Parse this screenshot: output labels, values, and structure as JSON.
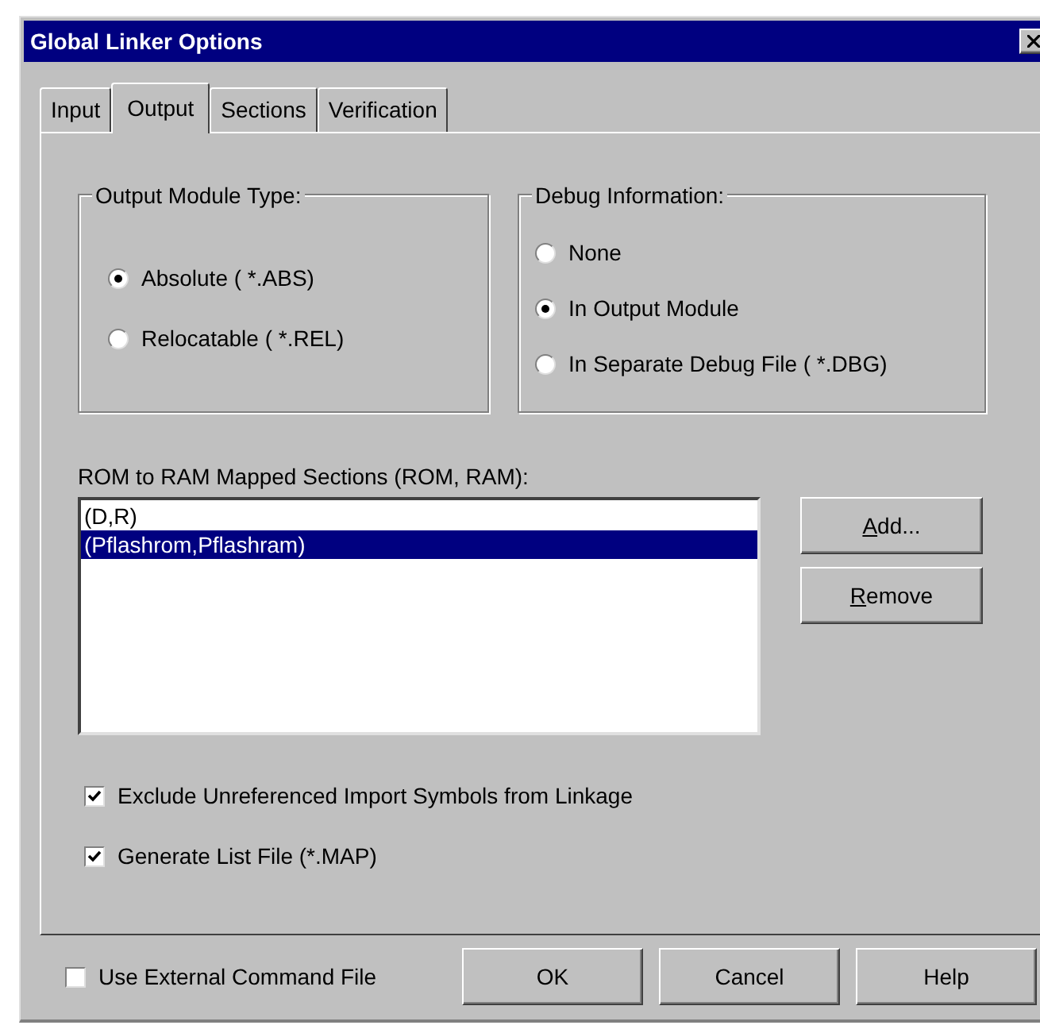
{
  "window": {
    "title": "Global Linker Options"
  },
  "tabs": [
    {
      "label": "Input",
      "selected": false
    },
    {
      "label": "Output",
      "selected": true
    },
    {
      "label": "Sections",
      "selected": false
    },
    {
      "label": "Verification",
      "selected": false
    }
  ],
  "output_module_type": {
    "title": "Output Module Type:",
    "options": [
      {
        "label": "Absolute ( *.ABS)",
        "selected": true
      },
      {
        "label": "Relocatable ( *.REL)",
        "selected": false
      }
    ]
  },
  "debug_information": {
    "title": "Debug Information:",
    "options": [
      {
        "label": "None",
        "selected": false
      },
      {
        "label": "In Output Module",
        "selected": true
      },
      {
        "label": "In Separate Debug File ( *.DBG)",
        "selected": false
      }
    ]
  },
  "mapped_sections": {
    "label": "ROM to RAM Mapped Sections (ROM, RAM):",
    "items": [
      {
        "text": "(D,R)",
        "selected": false
      },
      {
        "text": "(Pflashrom,Pflashram)",
        "selected": true
      }
    ]
  },
  "list_buttons": [
    {
      "label": "Add...",
      "underline_first": true
    },
    {
      "label": "Remove",
      "underline_first": true
    }
  ],
  "options": [
    {
      "label": "Exclude Unreferenced Import Symbols from Linkage",
      "checked": true
    },
    {
      "label": "Generate List File (*.MAP)",
      "checked": true
    }
  ],
  "footer": {
    "external_command_file": {
      "label": "Use External Command File",
      "checked": false
    },
    "buttons": [
      "OK",
      "Cancel",
      "Help"
    ]
  }
}
